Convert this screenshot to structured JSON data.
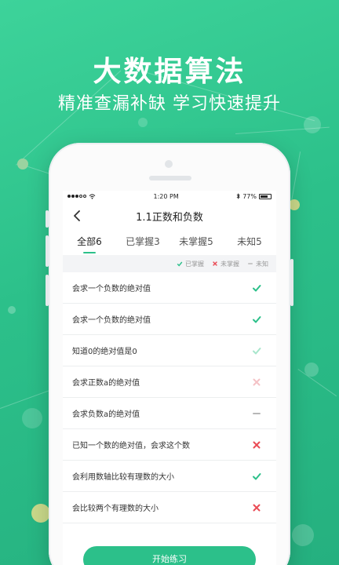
{
  "headline": "大数据算法",
  "subline": "精准查漏补缺 学习快速提升",
  "status_bar": {
    "time": "1:20 PM",
    "battery": "77%",
    "battery_level": 0.77
  },
  "nav": {
    "title": "1.1正数和负数"
  },
  "tabs": [
    {
      "label": "全部6",
      "active": true
    },
    {
      "label": "已掌握3",
      "active": false
    },
    {
      "label": "未掌握5",
      "active": false
    },
    {
      "label": "未知5",
      "active": false
    }
  ],
  "legend": {
    "mastered": "已掌握",
    "not_mastered": "未掌握",
    "unknown": "未知"
  },
  "colors": {
    "accent": "#2cc08a",
    "check": "#2cc08a",
    "check_faded": "#a8e6cc",
    "cross": "#ea4b55",
    "cross_faded": "#f4c2c6",
    "dash": "#b7b7b7"
  },
  "items": [
    {
      "text": "会求一个负数的绝对值",
      "status": "check"
    },
    {
      "text": "会求一个负数的绝对值",
      "status": "check"
    },
    {
      "text": "知道0的绝对值是0",
      "status": "check_faded"
    },
    {
      "text": "会求正数a的绝对值",
      "status": "cross_faded"
    },
    {
      "text": "会求负数a的绝对值",
      "status": "dash"
    },
    {
      "text": "已知一个数的绝对值，会求这个数",
      "status": "cross"
    },
    {
      "text": "会利用数轴比较有理数的大小",
      "status": "check"
    },
    {
      "text": "会比较两个有理数的大小",
      "status": "cross"
    }
  ],
  "start_button": "开始练习"
}
